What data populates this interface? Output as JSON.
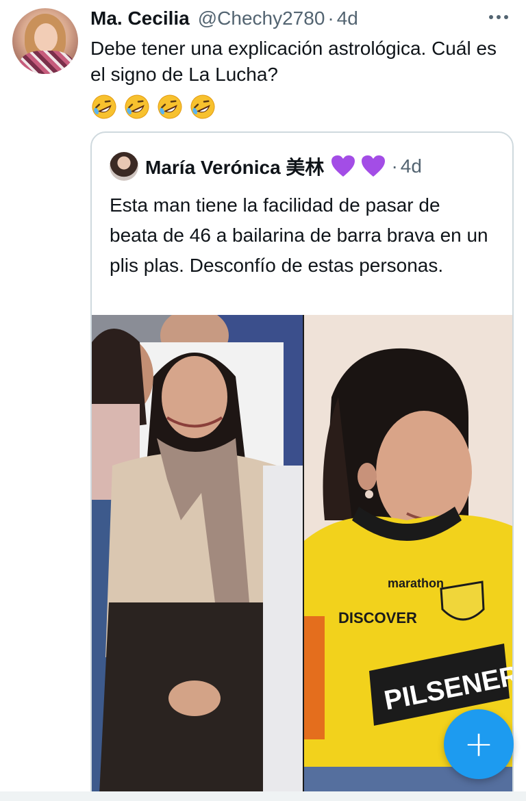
{
  "tweet": {
    "author_name": "Ma. Cecilia",
    "author_handle": "@Chechy2780",
    "separator": "·",
    "time": "4d",
    "text": "Debe tener una explicación astrológica. Cuál es el signo de La Lucha?",
    "emojis": [
      "rolling-on-floor-laughing",
      "rolling-on-floor-laughing",
      "rolling-on-floor-laughing",
      "rolling-on-floor-laughing"
    ]
  },
  "quoted_tweet": {
    "author_name": "María Verónica 美林",
    "hearts": [
      "purple-heart",
      "purple-heart"
    ],
    "separator": "·",
    "time": "4d",
    "text": "Esta man tiene la facilidad de pasar de beata de 46 a bailarina de barra brava en un plis plas. Desconfío de estas personas.",
    "media": {
      "right_image_jersey_texts": [
        "marathon",
        "DISCOVER",
        "PILSENER"
      ]
    }
  },
  "fab": {
    "label": "+"
  },
  "colors": {
    "accent": "#1d9bf0",
    "secondary_text": "#536471",
    "border": "#cfd9de",
    "jersey_yellow": "#f2d21c",
    "heart_purple": "#a34de6"
  }
}
